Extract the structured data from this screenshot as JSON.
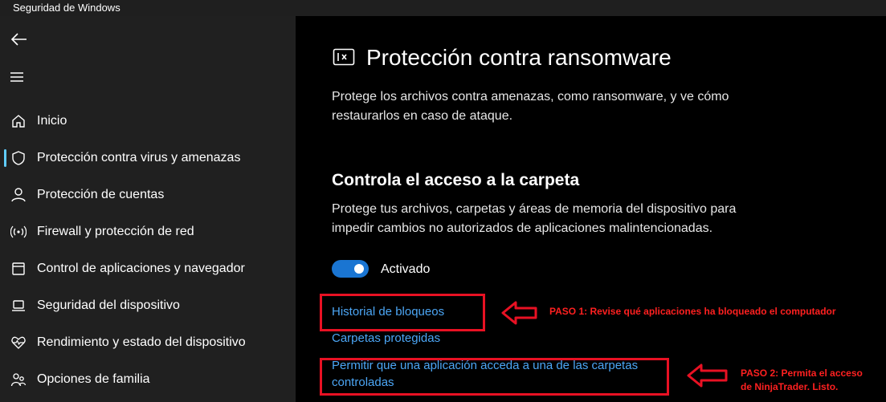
{
  "window": {
    "title": "Seguridad de Windows"
  },
  "sidebar": {
    "items": [
      {
        "label": "Inicio"
      },
      {
        "label": "Protección contra virus y amenazas"
      },
      {
        "label": "Protección de cuentas"
      },
      {
        "label": "Firewall y protección de red"
      },
      {
        "label": "Control de aplicaciones y navegador"
      },
      {
        "label": "Seguridad del dispositivo"
      },
      {
        "label": "Rendimiento y estado del dispositivo"
      },
      {
        "label": "Opciones de familia"
      }
    ]
  },
  "main": {
    "title": "Protección contra ransomware",
    "description_line1": "Protege los archivos contra amenazas, como ransomware, y ve cómo",
    "description_line2": "restaurarlos en caso de ataque.",
    "section": {
      "title": "Controla el acceso a la carpeta",
      "description_line1": "Protege tus archivos, carpetas y áreas de memoria del dispositivo para",
      "description_line2": "impedir cambios no autorizados de aplicaciones malintencionadas.",
      "toggle_label": "Activado",
      "toggle_on": true
    },
    "links": {
      "block_history": "Historial de bloqueos",
      "protected_folders": "Carpetas protegidas",
      "allow_app_line1": "Permitir que una aplicación acceda a una de las carpetas",
      "allow_app_line2": "controladas"
    }
  },
  "annotations": {
    "step1": "PASO 1: Revise qué aplicaciones ha bloqueado el computador",
    "step2_line1": "PASO 2: Permita el acceso",
    "step2_line2": "de NinjaTrader. Listo.",
    "color": "#e81123"
  },
  "colors": {
    "accent": "#1a75d2",
    "link": "#4ca6f5",
    "sidebar_bg": "#202020"
  }
}
